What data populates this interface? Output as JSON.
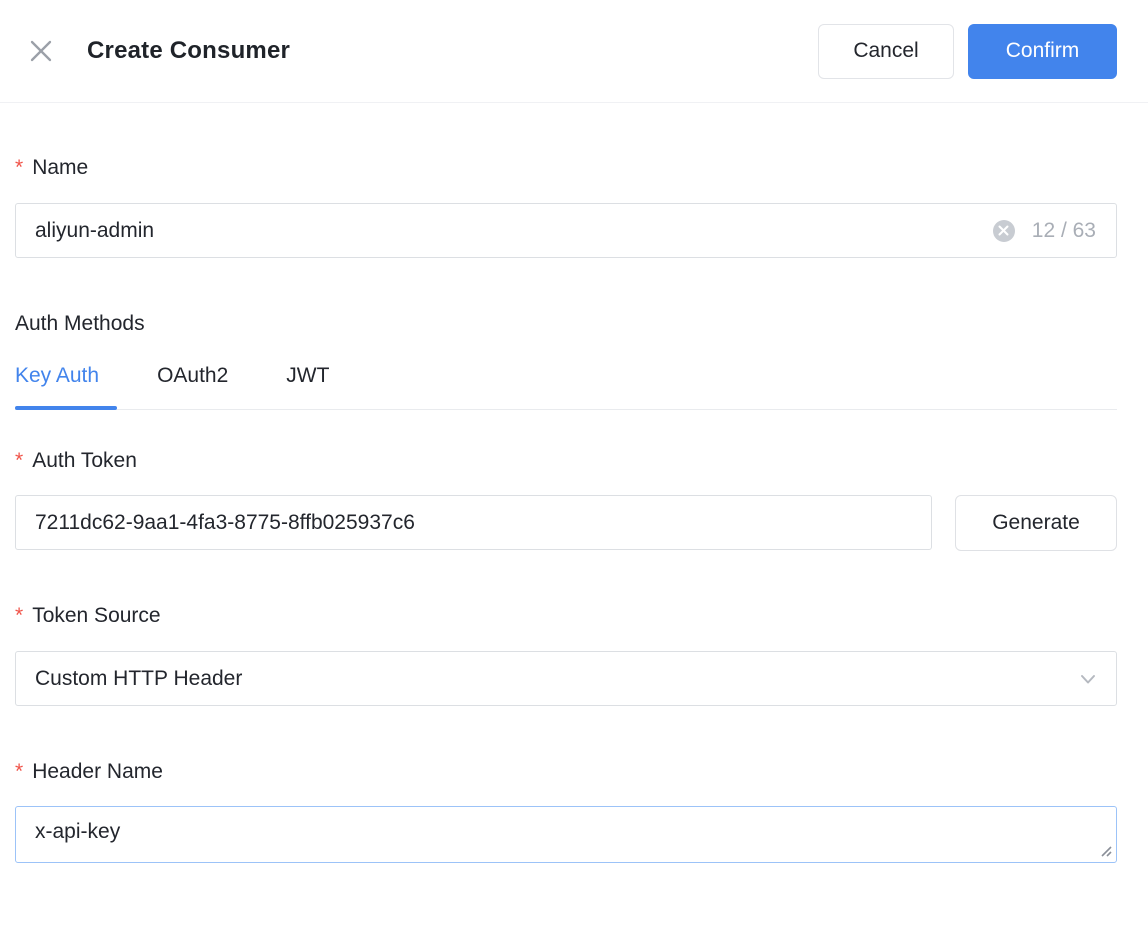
{
  "required_mark": "*",
  "colors": {
    "accent": "#4284EC",
    "required_red": "#F0544A",
    "text_dark": "#23262d",
    "text_muted": "#a9aeb6",
    "border_input": "#dcdfe3",
    "border_focus": "#9cc3f8"
  },
  "header": {
    "title": "Create Consumer",
    "close_icon": "close-x",
    "cancel_label": "Cancel",
    "confirm_label": "Confirm"
  },
  "form": {
    "name": {
      "label": "Name",
      "value": "aliyun-admin",
      "counter": "12 / 63",
      "clear_icon": "circle-x-clear"
    },
    "auth_methods": {
      "label": "Auth Methods",
      "tabs": [
        {
          "label": "Key Auth",
          "active": true
        },
        {
          "label": "OAuth2",
          "active": false
        },
        {
          "label": "JWT",
          "active": false
        }
      ]
    },
    "auth_token": {
      "label": "Auth Token",
      "value": "7211dc62-9aa1-4fa3-8775-8ffb025937c6",
      "generate_label": "Generate"
    },
    "token_source": {
      "label": "Token Source",
      "value": "Custom HTTP Header",
      "chevron_icon": "chevron-down"
    },
    "header_name": {
      "label": "Header Name",
      "value": "x-api-key"
    }
  }
}
